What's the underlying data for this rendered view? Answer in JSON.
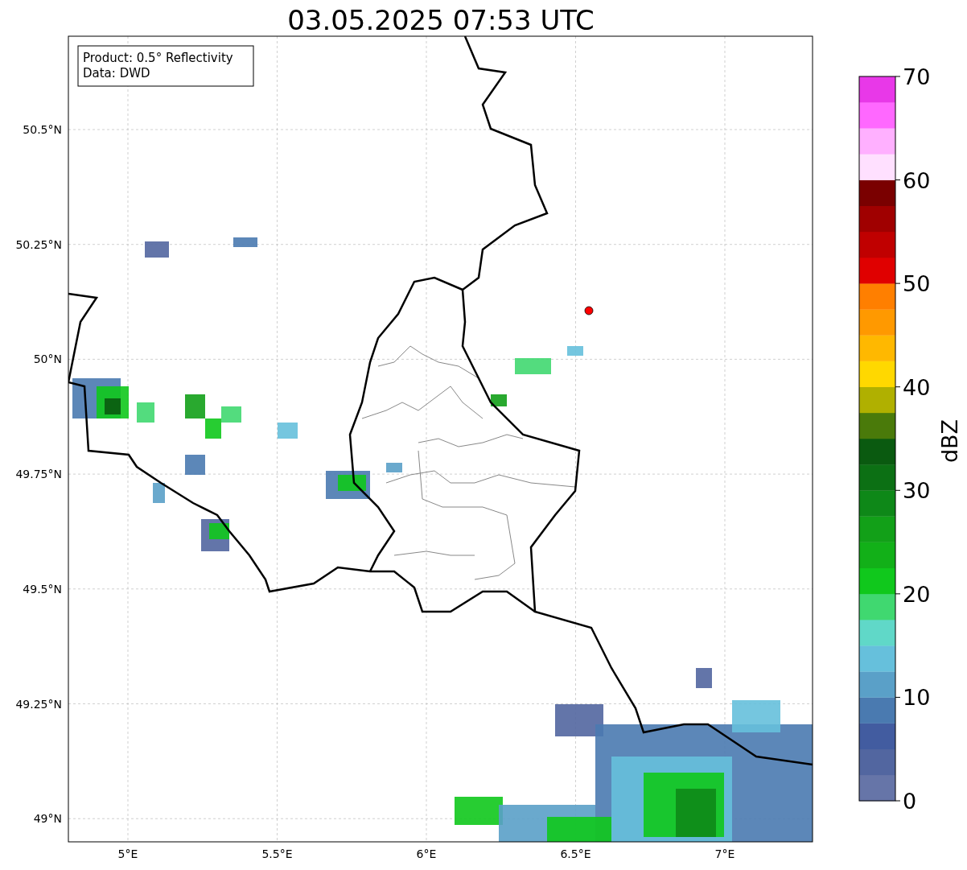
{
  "title": "03.05.2025 07:53 UTC",
  "legend": [
    "Product: 0.5° Reflectivity",
    "Data: DWD"
  ],
  "map": {
    "xticks": [
      "5°E",
      "5.5°E",
      "6°E",
      "6.5°E",
      "7°E"
    ],
    "yticks": [
      "50.5°N",
      "50.25°N",
      "50°N",
      "49.75°N",
      "49.5°N",
      "49.25°N",
      "49°N"
    ]
  },
  "colorbar": {
    "label": "dBZ",
    "ticks": [
      "70",
      "60",
      "50",
      "40",
      "30",
      "20",
      "10",
      "0"
    ],
    "bands": [
      {
        "color": "#6675a8"
      },
      {
        "color": "#5266a0"
      },
      {
        "color": "#425ca0"
      },
      {
        "color": "#4a7ab0"
      },
      {
        "color": "#5aa0c8"
      },
      {
        "color": "#66c0dc"
      },
      {
        "color": "#60d8c8"
      },
      {
        "color": "#40d870"
      },
      {
        "color": "#10c81c"
      },
      {
        "color": "#12b018"
      },
      {
        "color": "#12a018"
      },
      {
        "color": "#0e8818"
      },
      {
        "color": "#0c7014"
      },
      {
        "color": "#0a5a10"
      },
      {
        "color": "#4a7a0a"
      },
      {
        "color": "#b0b000"
      },
      {
        "color": "#ffd800"
      },
      {
        "color": "#ffb800"
      },
      {
        "color": "#ff9900"
      },
      {
        "color": "#ff7f00"
      },
      {
        "color": "#e00000"
      },
      {
        "color": "#c00000"
      },
      {
        "color": "#a00000"
      },
      {
        "color": "#7a0000"
      },
      {
        "color": "#ffe0ff"
      },
      {
        "color": "#ffb0ff"
      },
      {
        "color": "#ff68ff"
      },
      {
        "color": "#e838e8"
      }
    ]
  }
}
